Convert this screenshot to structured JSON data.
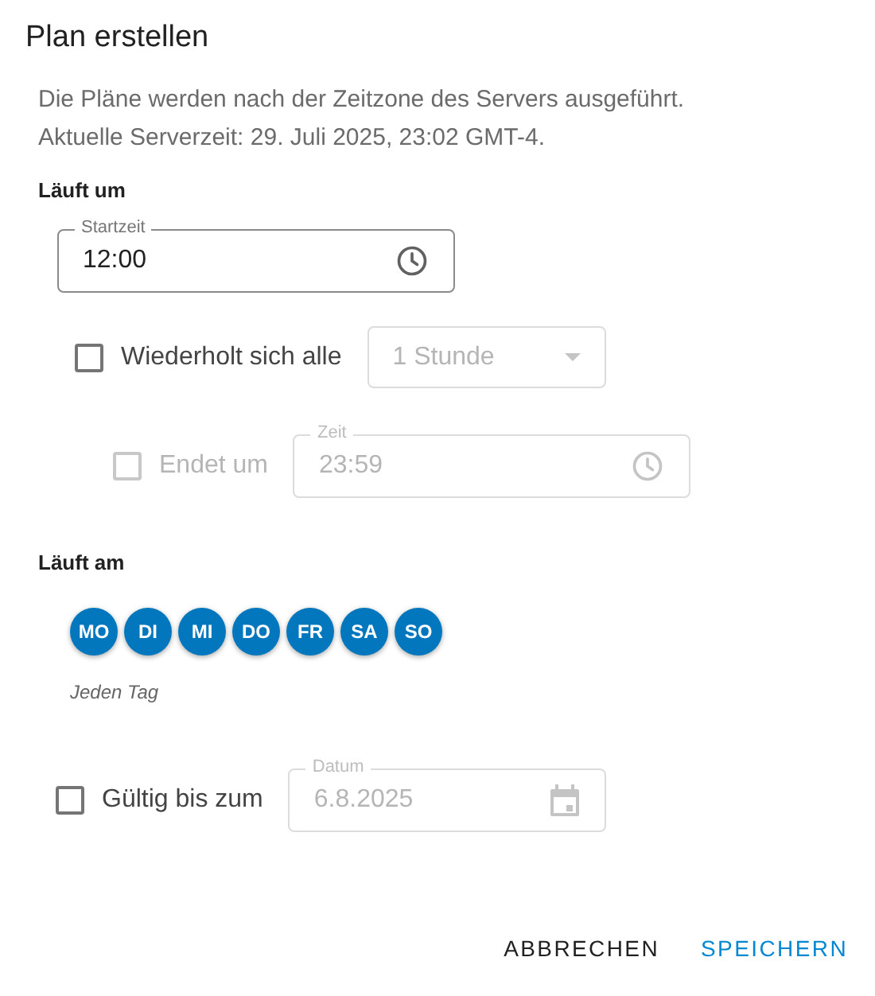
{
  "dialog": {
    "title": "Plan erstellen"
  },
  "description": [
    "Die Pläne werden nach der Zeitzone des Servers ausgeführt.",
    "Aktuelle Serverzeit: 29. Juli 2025, 23:02 GMT-4."
  ],
  "runs_at": {
    "heading": "Läuft um",
    "start_time": {
      "label": "Startzeit",
      "value": "12:00",
      "disabled": false
    },
    "repeat": {
      "label": "Wiederholt sich alle",
      "checked": false,
      "interval": {
        "value": "1 Stunde",
        "disabled": true
      }
    },
    "ends": {
      "label": "Endet um",
      "checked": false,
      "disabled": true,
      "field": {
        "label": "Zeit",
        "value": "23:59",
        "disabled": true
      }
    }
  },
  "runs_on": {
    "heading": "Läuft am",
    "days": [
      {
        "label": "MO",
        "selected": true
      },
      {
        "label": "DI",
        "selected": true
      },
      {
        "label": "MI",
        "selected": true
      },
      {
        "label": "DO",
        "selected": true
      },
      {
        "label": "FR",
        "selected": true
      },
      {
        "label": "SA",
        "selected": true
      },
      {
        "label": "SO",
        "selected": true
      }
    ],
    "summary": "Jeden Tag"
  },
  "valid_until": {
    "label": "Gültig bis zum",
    "checked": false,
    "field": {
      "label": "Datum",
      "value": "6.8.2025",
      "disabled": true
    }
  },
  "buttons": [
    {
      "label": "ABBRECHEN",
      "kind": "secondary"
    },
    {
      "label": "SPEICHERN",
      "kind": "primary"
    }
  ]
}
